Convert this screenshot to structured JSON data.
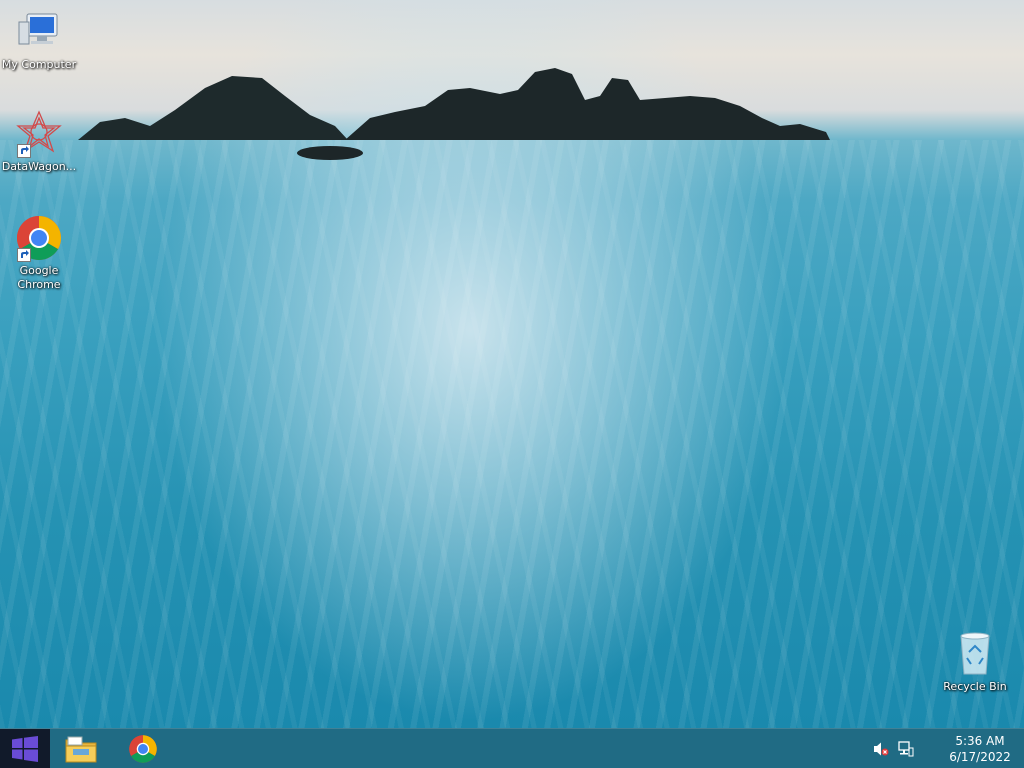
{
  "desktop": {
    "icons": [
      {
        "label": "My Computer",
        "icon": "computer-icon"
      },
      {
        "label": "DataWagon...",
        "icon": "datawagon-icon",
        "shortcut": true
      },
      {
        "label": "Google Chrome",
        "icon": "chrome-icon",
        "shortcut": true
      },
      {
        "label": "Recycle Bin",
        "icon": "recycle-bin-icon"
      }
    ]
  },
  "taskbar": {
    "start": {
      "icon": "windows-logo-icon"
    },
    "pinned": [
      {
        "name": "File Explorer",
        "icon": "file-explorer-icon"
      },
      {
        "name": "Google Chrome",
        "icon": "chrome-icon"
      }
    ],
    "tray": {
      "icons": [
        "volume-muted-icon",
        "network-icon"
      ]
    },
    "clock": {
      "time": "5:36 AM",
      "date": "6/17/2022"
    }
  },
  "colors": {
    "taskbar": "#1f6880",
    "start_button": "#111a2a",
    "windows_logo": "#6a4cd6"
  }
}
